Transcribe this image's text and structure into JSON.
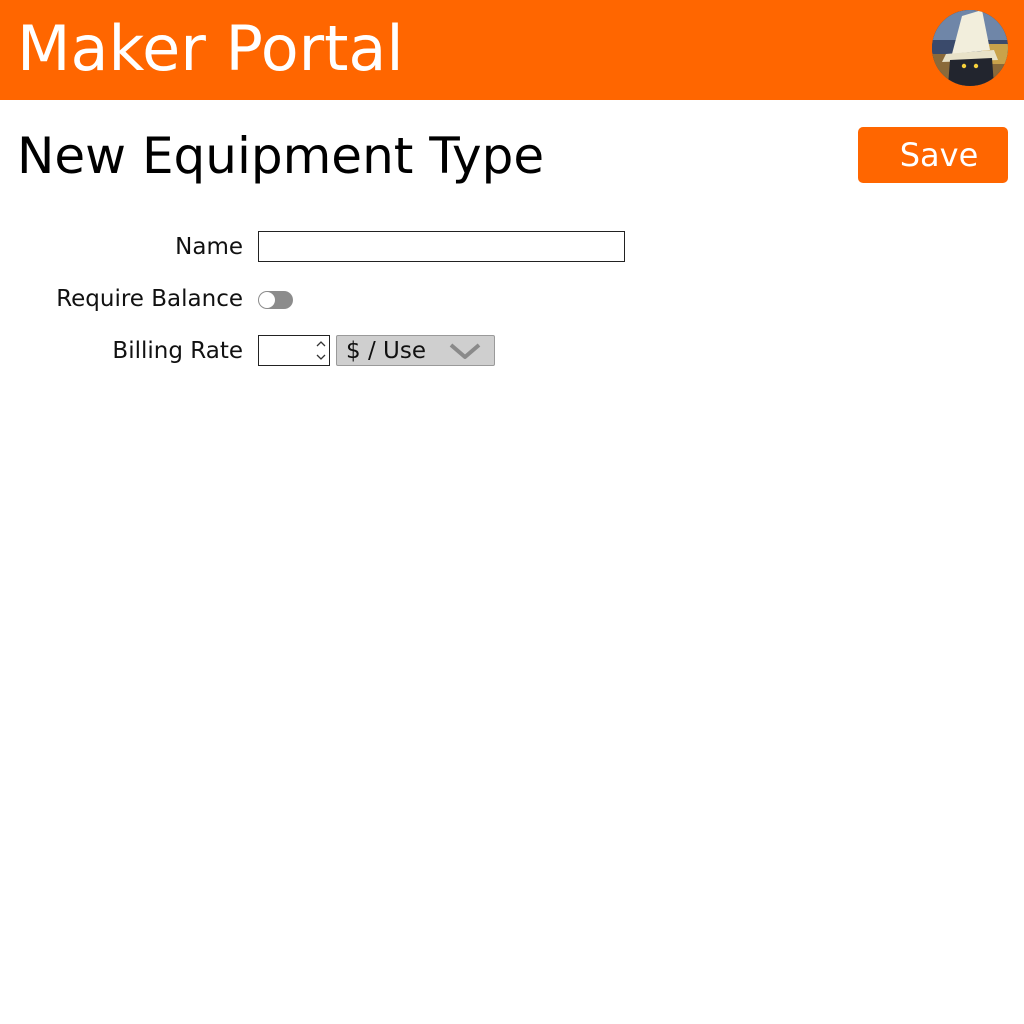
{
  "header": {
    "app_title": "Maker Portal",
    "brand_color": "#ff6600",
    "avatar_icon": "user-avatar"
  },
  "page": {
    "title": "New Equipment Type",
    "save_label": "Save"
  },
  "form": {
    "name": {
      "label": "Name",
      "value": "",
      "placeholder": ""
    },
    "require_balance": {
      "label": "Require Balance",
      "checked": false
    },
    "billing_rate": {
      "label": "Billing Rate",
      "value": "",
      "unit_selected": "$ / Use"
    }
  }
}
